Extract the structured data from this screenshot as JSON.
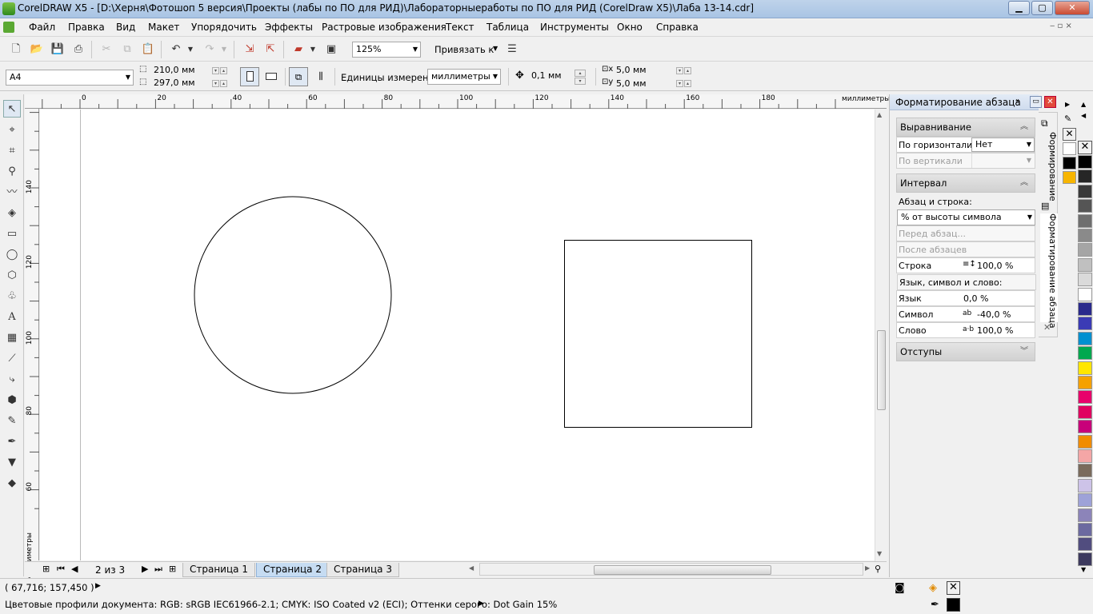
{
  "window": {
    "title": "CorelDRAW X5 - [D:\\Херня\\Фотошоп 5 версия\\Проекты (лабы по ПО для РИД)\\Лабораторныеработы по ПО для РИД (CorelDraw X5)\\Лаба 13-14.cdr]",
    "min": "▁",
    "max": "▢",
    "close": "✕"
  },
  "menu": [
    "Файл",
    "Правка",
    "Вид",
    "Макет",
    "Упорядочить",
    "Эффекты",
    "Растровые изображения",
    "Текст",
    "Таблица",
    "Инструменты",
    "Окно",
    "Справка"
  ],
  "toolbar": {
    "zoom": "125%",
    "snap": "Привязать к"
  },
  "property_bar": {
    "page_size": "A4",
    "width": "210,0 мм",
    "height": "297,0 мм",
    "units_label": "Единицы измерения:",
    "units": "миллиметры",
    "nudge": "0,1 мм",
    "dup_x": "5,0 мм",
    "dup_y": "5,0 мм"
  },
  "ruler": {
    "h_labels": [
      "0",
      "20",
      "40",
      "60",
      "80",
      "100",
      "120",
      "140",
      "160",
      "180"
    ],
    "h_units": "миллиметры",
    "v_labels": [
      "140",
      "120",
      "100",
      "80",
      "60"
    ],
    "v_units": "миллиметры"
  },
  "pages": {
    "counter": "2 из 3",
    "tabs": [
      "Страница 1",
      "Страница 2",
      "Страница 3"
    ],
    "active": 1
  },
  "docker": {
    "title": "Форматирование абзаца",
    "align": {
      "header": "Выравнивание",
      "horizontal_label": "По горизонтали",
      "horizontal_value": "Нет",
      "vertical_label": "По вертикали"
    },
    "spacing": {
      "header": "Интервал",
      "para_line_label": "Абзац и строка:",
      "mode": "% от высоты символа",
      "before_label": "Перед абзац...",
      "after_label": "После абзацев",
      "line_label": "Строка",
      "line_value": "100,0 %",
      "lang_section": "Язык, символ и слово:",
      "lang_label": "Язык",
      "lang_value": "0,0 %",
      "char_label": "Символ",
      "char_value": "-40,0 %",
      "word_label": "Слово",
      "word_value": "100,0 %"
    },
    "indent_header": "Отступы",
    "tab1": "Формирование",
    "tab2": "Форматирование абзаца"
  },
  "palette_colors": [
    "#ffffff",
    "#000000",
    "#f7b500"
  ],
  "palette2_colors": [
    "#000000",
    "#262626",
    "#3a3a3a",
    "#555555",
    "#6e6e6e",
    "#8a8a8a",
    "#a5a5a5",
    "#c0c0c0",
    "#dadada",
    "#ffffff",
    "#2a2a8c",
    "#3b3bb5",
    "#0090d0",
    "#00a84f",
    "#ffe600",
    "#f5a100",
    "#e8006b",
    "#e00060",
    "#c8007a",
    "#f08c00",
    "#f4a6a6",
    "#7a6b5c",
    "#cdc3e8",
    "#9ea2d8",
    "#8c84b9",
    "#6c6aa0",
    "#514d7f",
    "#3d3a5e"
  ],
  "status": {
    "coords": "( 67,716; 157,450 )",
    "profiles": "Цветовые профили документа: RGB: sRGB IEC61966-2.1; CMYK: ISO Coated v2 (ECI); Оттенки серого: Dot Gain 15%"
  },
  "colors": {
    "title_bg": "#bfd3ea",
    "accent_tab": "#c6dcf2",
    "fill_swatch": "#000000"
  }
}
